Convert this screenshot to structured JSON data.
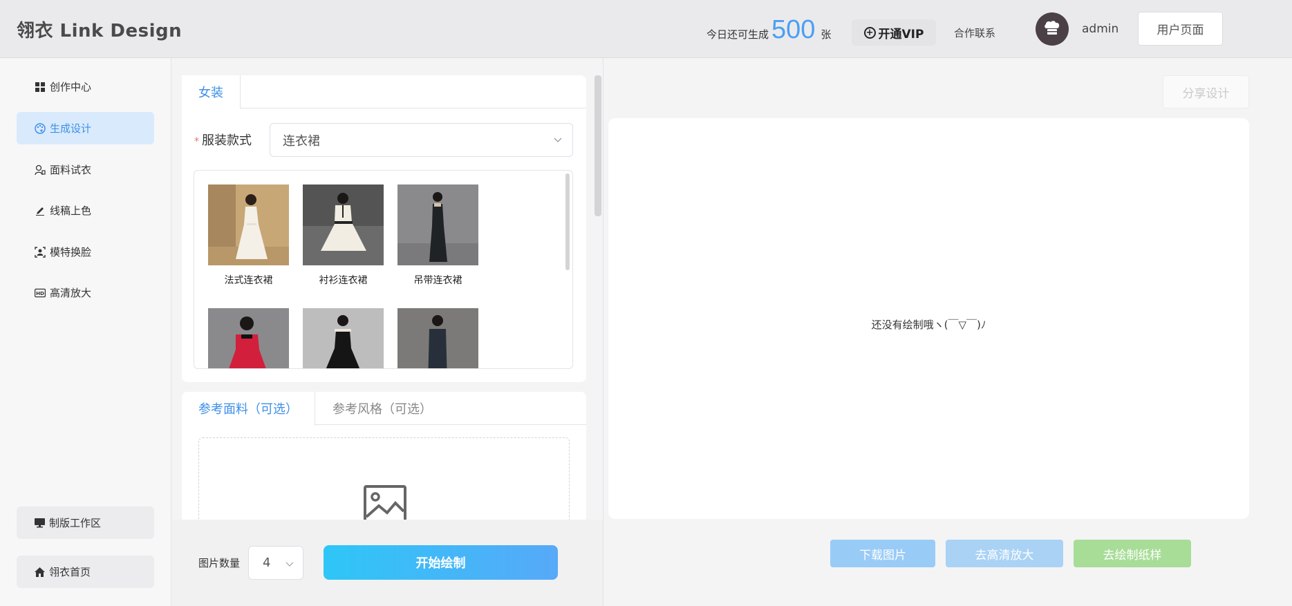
{
  "header": {
    "logo": "翎衣 Link Design",
    "quota_prefix": "今日还可生成",
    "quota_value": "500",
    "quota_unit": "张",
    "vip_label": "开通VIP",
    "contact_label": "合作联系",
    "username": "admin",
    "user_page_label": "用户页面"
  },
  "sidebar": {
    "items": [
      {
        "label": "创作中心",
        "icon": "grid-icon"
      },
      {
        "label": "生成设计",
        "icon": "palette-icon"
      },
      {
        "label": "面料试衣",
        "icon": "user-icon"
      },
      {
        "label": "线稿上色",
        "icon": "pencil-icon"
      },
      {
        "label": "模特换脸",
        "icon": "face-icon"
      },
      {
        "label": "高清放大",
        "icon": "hd-icon"
      }
    ],
    "active_index": 1,
    "bottom": [
      {
        "label": "制版工作区",
        "icon": "monitor-icon"
      },
      {
        "label": "翎衣首页",
        "icon": "home-icon"
      }
    ]
  },
  "style_panel": {
    "tab": "女装",
    "field_label": "服装款式",
    "field_value": "连衣裙",
    "styles": [
      {
        "label": "法式连衣裙"
      },
      {
        "label": "衬衫连衣裙"
      },
      {
        "label": "吊带连衣裙"
      },
      {
        "label": ""
      },
      {
        "label": ""
      },
      {
        "label": ""
      }
    ]
  },
  "reference_panel": {
    "tabs": [
      "参考面料（可选）",
      "参考风格（可选）"
    ],
    "active_tab": 0
  },
  "controls": {
    "count_label": "图片数量",
    "count_value": "4",
    "start_label": "开始绘制"
  },
  "result": {
    "share_label": "分享设计",
    "empty_message": "还没有绘制哦ヽ(￣▽￣)ﾉ",
    "actions": [
      {
        "label": "下载图片",
        "color": "#99cbf7"
      },
      {
        "label": "去高清放大",
        "color": "#a9d2f5"
      },
      {
        "label": "去绘制纸样",
        "color": "#a8dd98"
      }
    ]
  },
  "colors": {
    "accent": "#3d8fe8",
    "quota": "#4a9ff5"
  }
}
